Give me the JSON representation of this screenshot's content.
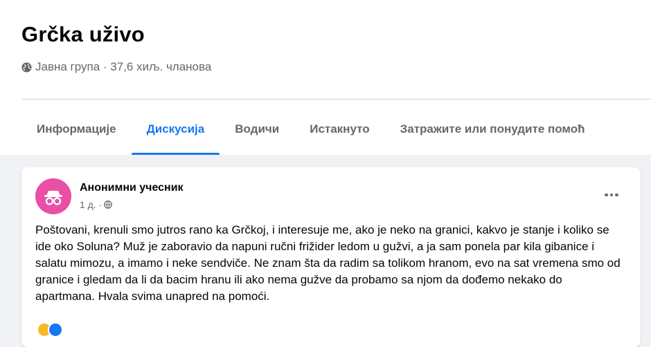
{
  "group": {
    "title": "Grčka uživo",
    "meta": "Јавна група · 37,6 хиљ. чланова"
  },
  "tabs": [
    {
      "label": "Информације",
      "active": false
    },
    {
      "label": "Дискусија",
      "active": true
    },
    {
      "label": "Водичи",
      "active": false
    },
    {
      "label": "Истакнуто",
      "active": false
    },
    {
      "label": "Затражите или понудите помоћ",
      "active": false
    }
  ],
  "post": {
    "author": "Анонимни учесник",
    "time": "1 д. ·",
    "text": "Poštovani, krenuli smo jutros rano ka Grčkoj, i interesuje me, ako je neko na granici, kakvo je stanje i koliko se ide oko Soluna? Muž je zaboravio da napuni ručni frižider ledom u gužvi, a ja sam ponela par kila gibanice i salatu mimozu, a imamo i neke sendviče. Ne znam šta da radim sa tolikom hranom, evo na sat vremena smo od granice i gledam da li da bacim hranu ili ako nema gužve da probamo sa njom da dođemo nekako do apartmana. Hvala svima unapred na pomoći."
  },
  "colors": {
    "accent": "#1877f2",
    "avatar": "#e94fa5",
    "muted_text": "#65676b",
    "background": "#f0f2f5"
  },
  "icons": {
    "privacy": "globe-icon",
    "audience": "globe-icon",
    "more": "more-options-icon",
    "avatar": "incognito-icon"
  }
}
